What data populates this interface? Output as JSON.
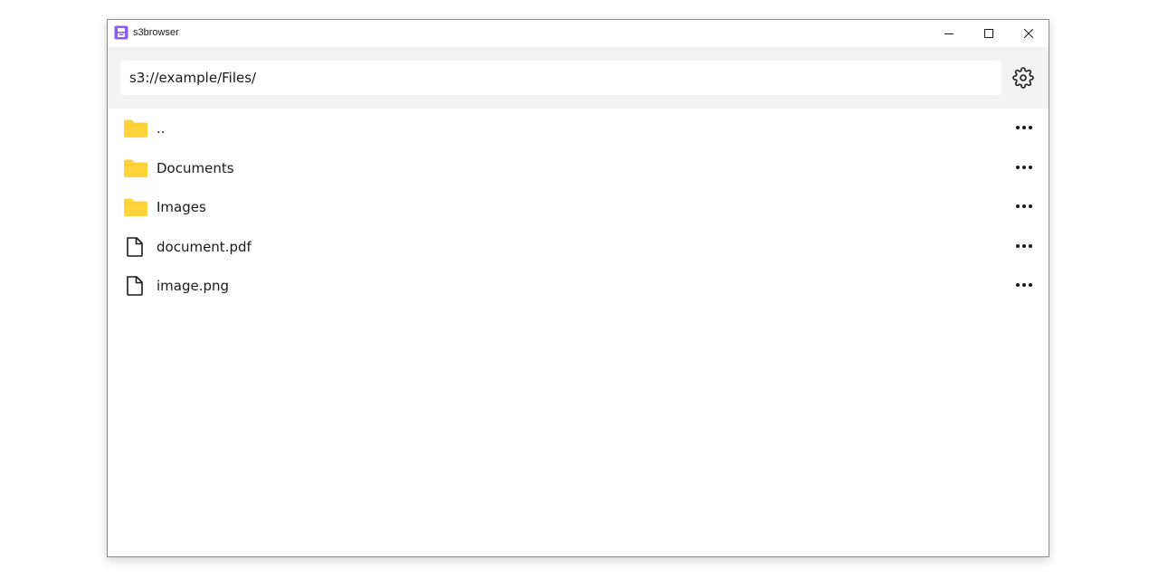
{
  "window": {
    "title": "s3browser"
  },
  "toolbar": {
    "path_value": "s3://example/Files/"
  },
  "icons": {
    "app": "app-icon",
    "settings": "gear-icon",
    "folder": "folder-icon",
    "file": "file-icon",
    "more": "more-horizontal-icon",
    "folder_color": "#FFD43B"
  },
  "entries": [
    {
      "name": "..",
      "type": "folder"
    },
    {
      "name": "Documents",
      "type": "folder"
    },
    {
      "name": "Images",
      "type": "folder"
    },
    {
      "name": "document.pdf",
      "type": "file"
    },
    {
      "name": "image.png",
      "type": "file"
    }
  ]
}
